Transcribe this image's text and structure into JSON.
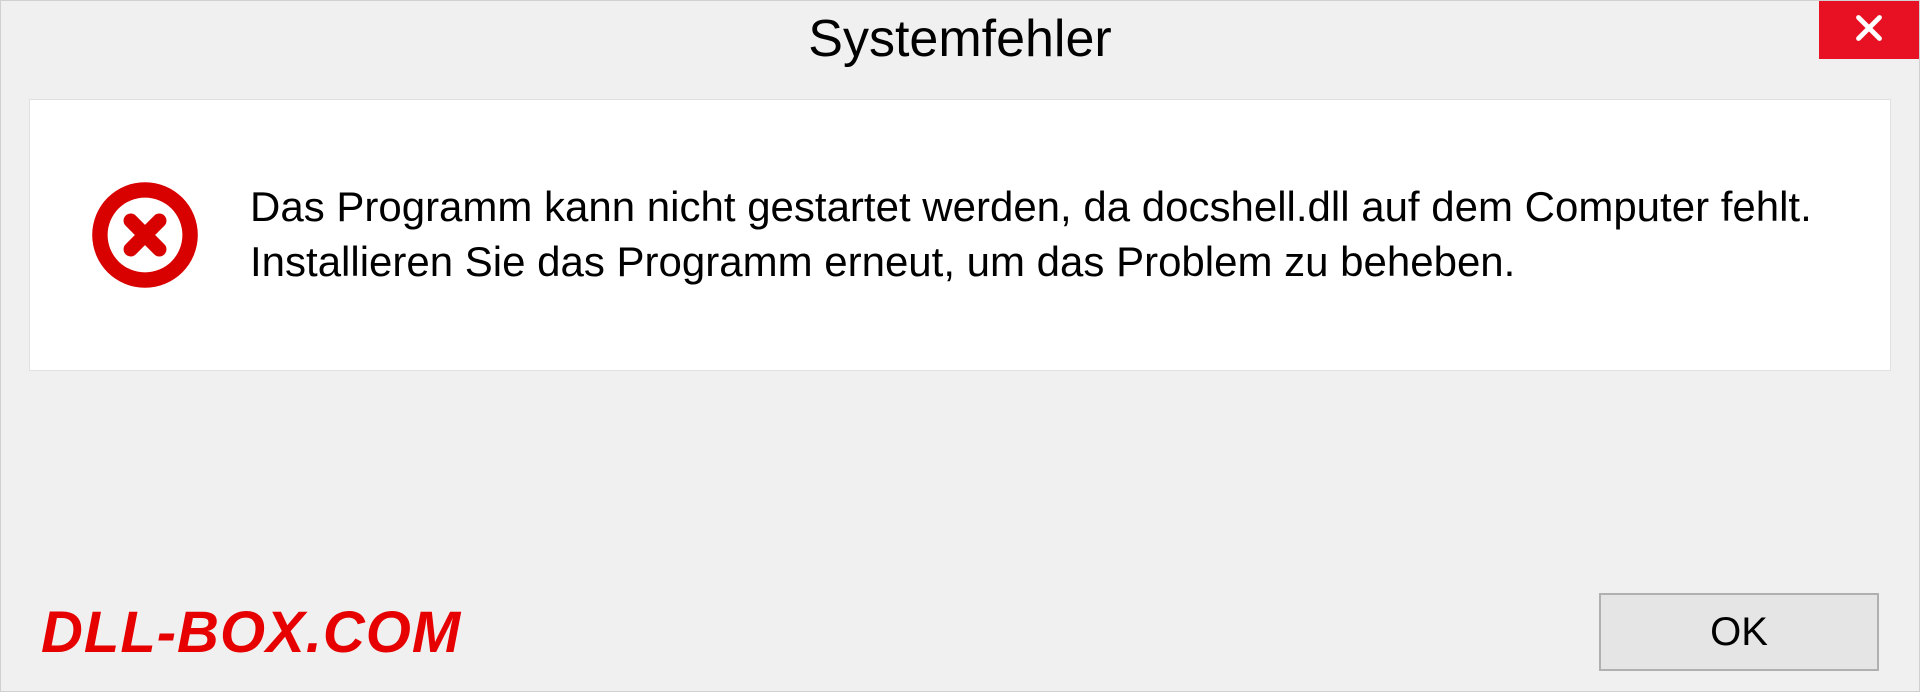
{
  "dialog": {
    "title": "Systemfehler",
    "message": "Das Programm kann nicht gestartet werden, da docshell.dll auf dem Computer fehlt. Installieren Sie das Programm erneut, um das Problem zu beheben.",
    "ok_label": "OK"
  },
  "watermark": "DLL-BOX.COM",
  "colors": {
    "close_bg": "#e81123",
    "error_icon": "#d90000",
    "watermark": "#e60000"
  }
}
